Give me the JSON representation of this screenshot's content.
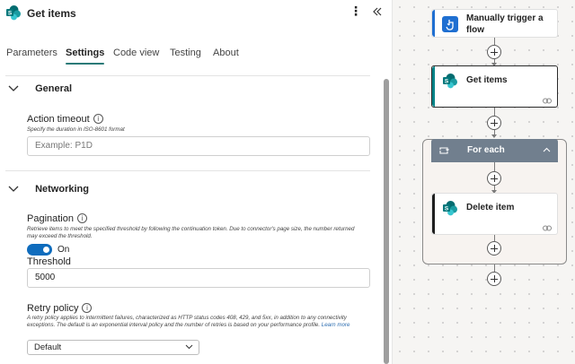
{
  "panel": {
    "title": "Get items",
    "more_glyph": "⋮",
    "tabs": [
      {
        "label": "Parameters"
      },
      {
        "label": "Settings"
      },
      {
        "label": "Code view"
      },
      {
        "label": "Testing"
      },
      {
        "label": "About"
      }
    ],
    "active_tab": "Settings",
    "sections": {
      "general": {
        "title": "General",
        "action_timeout": {
          "label": "Action timeout",
          "hint": "Specify the duration in ISO-8601 format",
          "placeholder": "Example: P1D"
        }
      },
      "networking": {
        "title": "Networking",
        "pagination": {
          "label": "Pagination",
          "hint": "Retrieve items to meet the specified threshold by following the continuation token. Due to connector's page size, the number returned may exceed the threshold.",
          "toggle_state": "On"
        },
        "threshold": {
          "label": "Threshold",
          "value": "5000"
        },
        "retry_policy": {
          "label": "Retry policy",
          "hint": "A retry policy applies to intermittent failures, characterized as HTTP status codes 408, 429, and 5xx, in addition to any connectivity exceptions. The default is an exponential interval policy and the number of retries is based on your performance profile.",
          "learn_more": "Learn more",
          "selected": "Default"
        }
      }
    }
  },
  "canvas": {
    "trigger": {
      "label": "Manually trigger a flow"
    },
    "get_items": {
      "label": "Get items"
    },
    "for_each": {
      "label": "For each"
    },
    "delete_item": {
      "label": "Delete item"
    }
  },
  "colors": {
    "accent": "#0f6cbd",
    "tab_underline": "#2b7a78",
    "scope_header": "#717f8e",
    "sharepoint": "#038387",
    "trigger_bar": "#1f6fd1"
  },
  "icons": [
    "sharepoint-icon",
    "more-icon",
    "collapse-panel-icon",
    "chevron-down-icon",
    "info-icon",
    "link-icon",
    "plus-icon",
    "loop-icon",
    "chevron-up-icon",
    "trigger-icon"
  ]
}
